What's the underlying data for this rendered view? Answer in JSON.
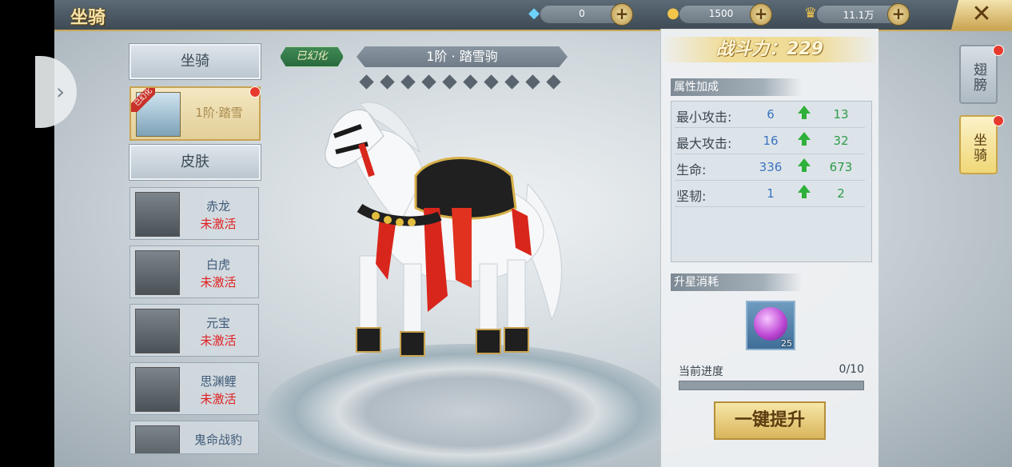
{
  "header": {
    "title": "坐骑",
    "resources": [
      {
        "icon": "diamond-icon",
        "value": "0"
      },
      {
        "icon": "gold-ingot-icon",
        "value": "1500"
      },
      {
        "icon": "trophy-icon",
        "value": "11.1万"
      }
    ]
  },
  "left_list": {
    "mount_header": "坐骑",
    "selected_mount": {
      "ribbon": "已幻化",
      "name": "1阶·踏雪"
    },
    "skin_header": "皮肤",
    "skins": [
      {
        "name": "赤龙",
        "status": "未激活"
      },
      {
        "name": "白虎",
        "status": "未激活"
      },
      {
        "name": "元宝",
        "status": "未激活"
      },
      {
        "name": "思渊鲤",
        "status": "未激活"
      },
      {
        "name": "鬼命战豹",
        "status": ""
      }
    ]
  },
  "center": {
    "badge": "已幻化",
    "mount_name": "1阶 · 踏雪驹",
    "stars_total": 10,
    "stars_filled": 0
  },
  "panel": {
    "combat_power": "战斗力：229",
    "attr_header": "属性加成",
    "stats": [
      {
        "label": "最小攻击:",
        "current": "6",
        "next": "13"
      },
      {
        "label": "最大攻击:",
        "current": "16",
        "next": "32"
      },
      {
        "label": "生命:",
        "current": "336",
        "next": "673"
      },
      {
        "label": "坚韧:",
        "current": "1",
        "next": "2"
      }
    ],
    "cost_header": "升星消耗",
    "item_count": "25",
    "progress_label": "当前进度",
    "progress_value": "0/10",
    "progress_fraction": 0,
    "upgrade_button": "一键提升"
  },
  "side_tabs": [
    {
      "label": "翅膀"
    },
    {
      "label": "坐骑"
    }
  ]
}
